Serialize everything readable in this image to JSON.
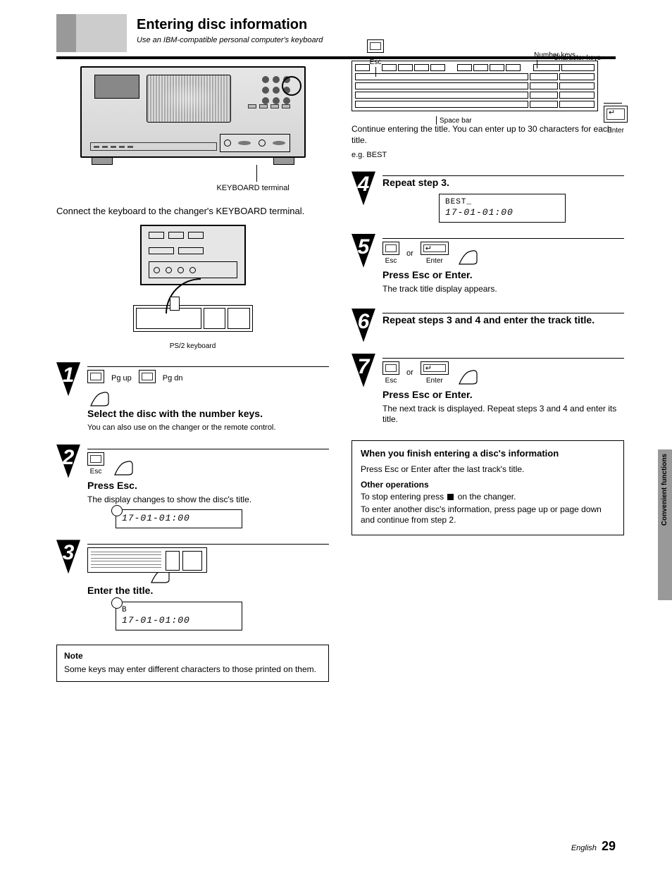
{
  "header": {
    "title": "Entering disc information",
    "subtitle": "Use an IBM-compatible personal computer's keyboard"
  },
  "labels": {
    "keyboard_terminal": "KEYBOARD terminal",
    "esc": "Esc",
    "character_keys": "Character keys",
    "number_keys": "Number keys",
    "space_bar": "Space bar",
    "enter": "Enter",
    "ps2_keyboard": "PS/2 keyboard",
    "or": "or",
    "pg_up": "Pg up",
    "pg_dn": "Pg dn"
  },
  "intro_left": "Connect the keyboard to the changer's KEYBOARD terminal.",
  "steps_left": {
    "s1": {
      "head": "Select the disc with the number keys.",
      "note": "You can also use          on the changer or the remote control."
    },
    "s2": {
      "head": "Press Esc.",
      "sub": "The display changes to show the disc's title.",
      "display_title": "",
      "display_time": "17-01-01:00"
    },
    "s3": {
      "head": "Enter the title.",
      "display_title": "B",
      "display_time": "17-01-01:00"
    }
  },
  "note_left": {
    "title": "Note",
    "body": "Some keys may enter different characters to those printed on them."
  },
  "intro_right": "Continue entering the title. You can enter up to 30 characters for each title.",
  "intro_right_ex": "e.g. BEST",
  "steps_right": {
    "s4": {
      "head": "Repeat step 3.",
      "display_title": "BEST_",
      "display_time": "17-01-01:00"
    },
    "s5": {
      "head": "Press Esc or Enter.",
      "sub": "The track title display appears."
    },
    "s6": {
      "head": "Repeat steps 3 and 4 and enter the track title."
    },
    "s7": {
      "head": "Press Esc or Enter.",
      "sub": "The next track is displayed. Repeat steps 3 and 4 and enter its title."
    }
  },
  "info_box": {
    "title": "When you finish entering a disc's information",
    "line1": "Press Esc or Enter after the last track's title.",
    "other_heading": "Other operations",
    "line2_pre": "To stop entering press ",
    "line2_post": " on the changer.",
    "line3": "To enter another disc's information, press page up or page down and continue from step 2."
  },
  "side_tab": "Convenient functions",
  "page_footer": {
    "label": "English",
    "num": "29"
  }
}
